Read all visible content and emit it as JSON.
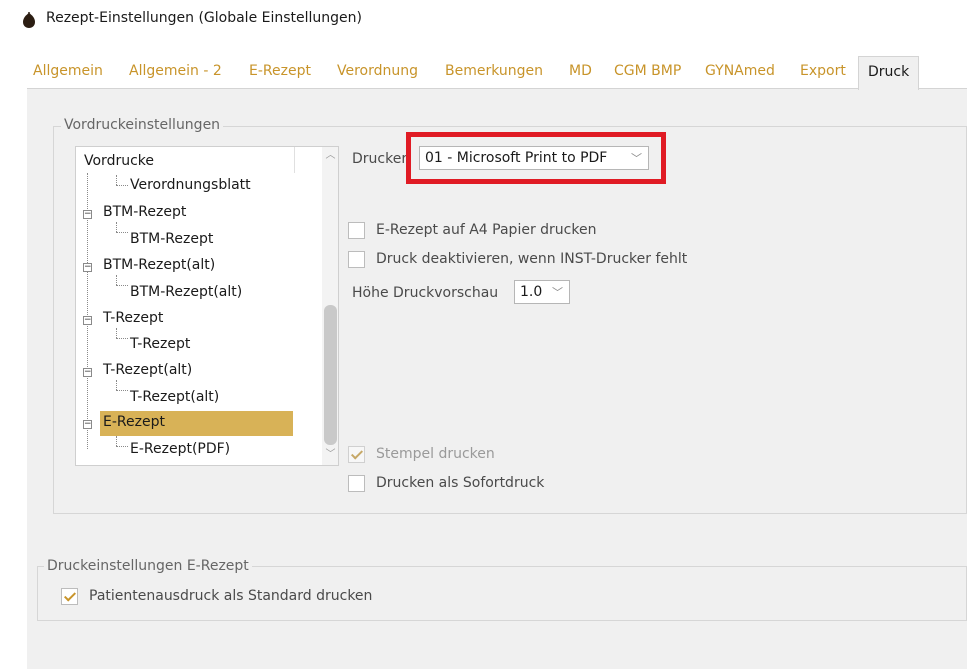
{
  "window": {
    "title": "Rezept-Einstellungen (Globale Einstellungen)",
    "icon": "app-seed-icon"
  },
  "tabs": [
    {
      "label": "Allgemein",
      "active": false
    },
    {
      "label": "Allgemein - 2",
      "active": false
    },
    {
      "label": "E-Rezept",
      "active": false
    },
    {
      "label": "Verordnung",
      "active": false
    },
    {
      "label": "Bemerkungen",
      "active": false
    },
    {
      "label": "MD",
      "active": false
    },
    {
      "label": "CGM BMP",
      "active": false
    },
    {
      "label": "GYNAmed",
      "active": false
    },
    {
      "label": "Export",
      "active": false
    },
    {
      "label": "Druck",
      "active": true
    }
  ],
  "vordruck_group": {
    "title": "Vordruckeinstellungen",
    "tree_header": "Vordrucke",
    "tree_items": [
      {
        "label": "Verordnungsblatt",
        "level": 1
      },
      {
        "label": "BTM-Rezept",
        "level": 0
      },
      {
        "label": "BTM-Rezept",
        "level": 1
      },
      {
        "label": "BTM-Rezept(alt)",
        "level": 0
      },
      {
        "label": "BTM-Rezept(alt)",
        "level": 1
      },
      {
        "label": "T-Rezept",
        "level": 0
      },
      {
        "label": "T-Rezept",
        "level": 1
      },
      {
        "label": "T-Rezept(alt)",
        "level": 0
      },
      {
        "label": "T-Rezept(alt)",
        "level": 1
      },
      {
        "label": "E-Rezept",
        "level": 0,
        "selected": true
      },
      {
        "label": "E-Rezept(PDF)",
        "level": 1
      }
    ],
    "drucker_label": "Drucker",
    "drucker_value": "01 - Microsoft Print to PDF",
    "options": [
      {
        "label": "E-Rezept auf A4 Papier drucken",
        "checked": false,
        "disabled": false
      },
      {
        "label": "Druck deaktivieren, wenn INST-Drucker fehlt",
        "checked": false,
        "disabled": false
      }
    ],
    "preview_label": "Höhe Druckvorschau",
    "preview_value": "1.0",
    "stempel": {
      "label": "Stempel drucken",
      "checked": true,
      "disabled": true
    },
    "sofortdruck": {
      "label": "Drucken als Sofortdruck",
      "checked": false,
      "disabled": false
    }
  },
  "erezept_group": {
    "title": "Druckeinstellungen E-Rezept",
    "patient": {
      "label": "Patientenausdruck als Standard drucken",
      "checked": true
    }
  },
  "colors": {
    "accent": "#c8942a",
    "selection": "#d8b257",
    "highlight": "#e01b24",
    "panel": "#f0f0f0"
  }
}
